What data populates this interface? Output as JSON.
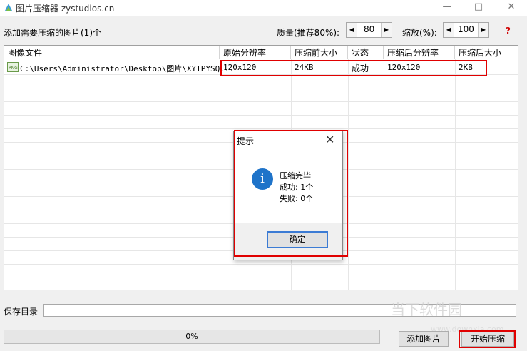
{
  "window": {
    "title": "图片压缩器 zystudios.cn"
  },
  "toolbar": {
    "added_label": "添加需要压缩的图片(1)个",
    "quality_label": "质量(推荐80%):",
    "quality_value": "80",
    "scale_label": "缩放(%):",
    "scale_value": "100",
    "help": "?"
  },
  "table": {
    "columns": [
      "图像文件",
      "原始分辨率",
      "压缩前大小",
      "状态",
      "压缩后分辨率",
      "压缩后大小"
    ],
    "rows": [
      {
        "file": "C:\\Users\\Administrator\\Desktop\\图片\\XYTPYSQ...",
        "orig_res": "120x120",
        "orig_size": "24KB",
        "status": "成功",
        "new_res": "120x120",
        "new_size": "2KB"
      }
    ]
  },
  "dialog": {
    "title": "提示",
    "message": "压缩完毕",
    "success": "成功: 1个",
    "fail": "失败: 0个",
    "ok_label": "确定"
  },
  "bottom": {
    "save_dir_label": "保存目录",
    "save_dir_value": "",
    "progress_text": "0%",
    "progress_value": 0,
    "add_button": "添加图片",
    "start_button": "开始压缩"
  },
  "watermark": {
    "text": "当下软件园",
    "url": "www.downxia.com"
  },
  "colors": {
    "highlight": "#e00000",
    "accent": "#1e73c9",
    "progress": "#06b025"
  }
}
